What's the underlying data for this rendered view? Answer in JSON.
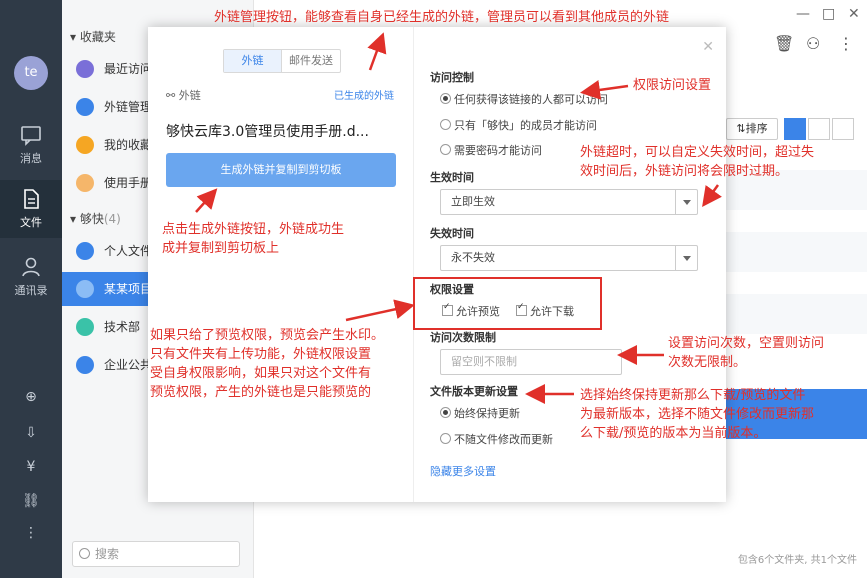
{
  "rail": {
    "avatar": "te",
    "items": [
      {
        "label": "消息"
      },
      {
        "label": "文件"
      },
      {
        "label": "通讯录"
      }
    ]
  },
  "sidebar": {
    "favorites_header": "收藏夹",
    "favorites": [
      {
        "label": "最近访问",
        "color": "#7a6fd8"
      },
      {
        "label": "外链管理",
        "color": "#3b84e8"
      },
      {
        "label": "我的收藏",
        "color": "#f5a623"
      },
      {
        "label": "使用手册",
        "color": "#f5b66a"
      }
    ],
    "group_header": "够快",
    "group_count": "(4)",
    "groups": [
      {
        "label": "个人文件",
        "color": "#3b84e8"
      },
      {
        "label": "某某项目",
        "color": "#5aa0f0"
      },
      {
        "label": "技术部",
        "color": "#3ac2a8"
      },
      {
        "label": "企业公共",
        "color": "#3b84e8"
      }
    ],
    "search_placeholder": "搜索"
  },
  "main": {
    "sort_label": "排序",
    "footer": "包含6个文件夹, 共1个文件",
    "window_controls": [
      "—",
      "□",
      "✕"
    ]
  },
  "dialog": {
    "tabs": [
      {
        "label": "外链",
        "active": true
      },
      {
        "label": "邮件发送",
        "active": false
      }
    ],
    "ext_label": "外链",
    "generated_link": "已生成的外链",
    "filename": "够快云库3.0管理员使用手册.d...",
    "generate_button": "生成外链并复制到剪切板",
    "access_title": "访问控制",
    "access_options": [
      {
        "label": "任何获得该链接的人都可以访问",
        "selected": true
      },
      {
        "label": "只有「够快」的成员才能访问",
        "selected": false
      },
      {
        "label": "需要密码才能访问",
        "selected": false
      }
    ],
    "effective_title": "生效时间",
    "effective_value": "立即生效",
    "expire_title": "失效时间",
    "expire_value": "永不失效",
    "perm_title": "权限设置",
    "perm_preview": "允许预览",
    "perm_download": "允许下载",
    "count_title": "访问次数限制",
    "count_placeholder": "留空则不限制",
    "version_title": "文件版本更新设置",
    "version_options": [
      {
        "label": "始终保持更新",
        "selected": true
      },
      {
        "label": "不随文件修改而更新",
        "selected": false
      }
    ],
    "more_settings": "隐藏更多设置"
  },
  "annotations": {
    "top": "外链管理按钮，能够查看自身已经生成的外链，管理员可以看到其他成员的外链",
    "access": "权限访问设置",
    "expire_line1": "外链超时，可以自定义失效时间，超过失",
    "expire_line2": "效时间后，外链访问将会限时过期。",
    "generate_line1": "点击生成外链按钮，外链成功生",
    "generate_line2": "成并复制到剪切板上",
    "preview_line1": "如果只给了预览权限，预览会产生水印。",
    "preview_line2": "只有文件夹有上传功能，外链权限设置",
    "preview_line3": "受自身权限影响，如果只对这个文件有",
    "preview_line4": "预览权限，产生的外链也是只能预览的",
    "count_line1": "设置访问次数，空置则访问",
    "count_line2": "次数无限制。",
    "version_line1": "选择始终保持更新那么下载/预览的文件",
    "version_line2": "为最新版本，选择不随文件修改而更新那",
    "version_line3": "么下载/预览的版本为当前版本。"
  }
}
